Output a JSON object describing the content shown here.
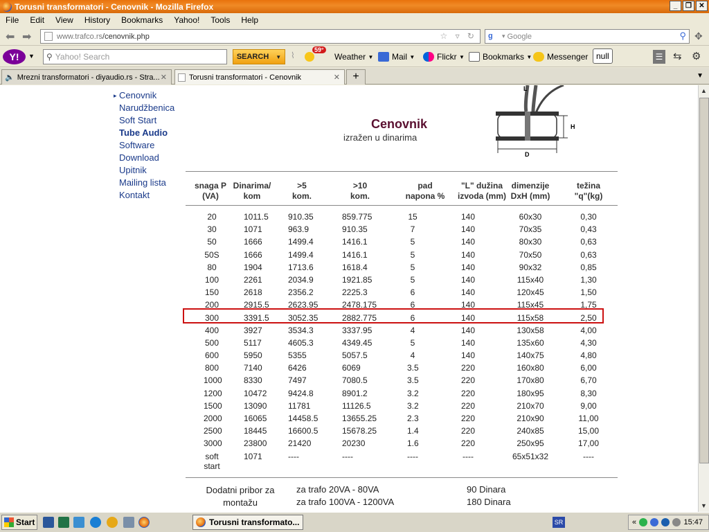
{
  "window": {
    "title": "Torusni transformatori - Cenovnik - Mozilla Firefox"
  },
  "menu": [
    "File",
    "Edit",
    "View",
    "History",
    "Bookmarks",
    "Yahoo!",
    "Tools",
    "Help"
  ],
  "nav": {
    "url_host": "www.trafco.rs",
    "url_path": "/cenovnik.php",
    "search_placeholder": "Google"
  },
  "yahoo_toolbar": {
    "search_placeholder": "Yahoo! Search",
    "search_button": "SEARCH",
    "weather_temp": "59°",
    "items": [
      "Weather",
      "Mail",
      "Flickr",
      "Bookmarks",
      "Messenger"
    ],
    "null_label": "null"
  },
  "tabs": [
    {
      "label": "Mrezni transformatori - diyaudio.rs - Stra...",
      "active": false
    },
    {
      "label": "Torusni transformatori - Cenovnik",
      "active": true
    }
  ],
  "sidenav": [
    {
      "label": "Cenovnik",
      "current": true,
      "bold": false
    },
    {
      "label": "Narudžbenica",
      "current": false,
      "bold": false
    },
    {
      "label": "Soft Start",
      "current": false,
      "bold": false
    },
    {
      "label": "Tube Audio",
      "current": false,
      "bold": true
    },
    {
      "label": "Software",
      "current": false,
      "bold": false
    },
    {
      "label": "Download",
      "current": false,
      "bold": false
    },
    {
      "label": "Upitnik",
      "current": false,
      "bold": false
    },
    {
      "label": "Mailing lista",
      "current": false,
      "bold": false
    },
    {
      "label": "Kontakt",
      "current": false,
      "bold": false
    }
  ],
  "page": {
    "heading": "Cenovnik",
    "subheading": "izražen u dinarima",
    "diagram_labels": {
      "L": "L",
      "H": "H",
      "D": "D"
    }
  },
  "table": {
    "headers": [
      [
        "snaga P",
        "(VA)"
      ],
      [
        "Dinarima/",
        "kom"
      ],
      [
        ">5",
        "kom."
      ],
      [
        ">10",
        "kom."
      ],
      [
        "pad",
        "napona %"
      ],
      [
        "\"L\" dužina",
        "izvoda (mm)"
      ],
      [
        "dimenzije",
        "DxH (mm)"
      ],
      [
        "težina",
        "\"q\"(kg)"
      ]
    ],
    "rows": [
      [
        "20",
        "1011.5",
        "910.35",
        "859.775",
        "15",
        "140",
        "60x30",
        "0,30"
      ],
      [
        "30",
        "1071",
        "963.9",
        "910.35",
        "7",
        "140",
        "70x35",
        "0,43"
      ],
      [
        "50",
        "1666",
        "1499.4",
        "1416.1",
        "5",
        "140",
        "80x30",
        "0,63"
      ],
      [
        "50S",
        "1666",
        "1499.4",
        "1416.1",
        "5",
        "140",
        "70x50",
        "0,63"
      ],
      [
        "80",
        "1904",
        "1713.6",
        "1618.4",
        "5",
        "140",
        "90x32",
        "0,85"
      ],
      [
        "100",
        "2261",
        "2034.9",
        "1921.85",
        "5",
        "140",
        "115x40",
        "1,30"
      ],
      [
        "150",
        "2618",
        "2356.2",
        "2225.3",
        "6",
        "140",
        "120x45",
        "1,50"
      ],
      [
        "200",
        "2915.5",
        "2623.95",
        "2478.175",
        "6",
        "140",
        "115x45",
        "1,75"
      ],
      [
        "300",
        "3391.5",
        "3052.35",
        "2882.775",
        "6",
        "140",
        "115x58",
        "2,50"
      ],
      [
        "400",
        "3927",
        "3534.3",
        "3337.95",
        "4",
        "140",
        "130x58",
        "4,00"
      ],
      [
        "500",
        "5117",
        "4605.3",
        "4349.45",
        "5",
        "140",
        "135x60",
        "4,30"
      ],
      [
        "600",
        "5950",
        "5355",
        "5057.5",
        "4",
        "140",
        "140x75",
        "4,80"
      ],
      [
        "800",
        "7140",
        "6426",
        "6069",
        "3.5",
        "220",
        "160x80",
        "6,00"
      ],
      [
        "1000",
        "8330",
        "7497",
        "7080.5",
        "3.5",
        "220",
        "170x80",
        "6,70"
      ],
      [
        "1200",
        "10472",
        "9424.8",
        "8901.2",
        "3.2",
        "220",
        "180x95",
        "8,30"
      ],
      [
        "1500",
        "13090",
        "11781",
        "11126.5",
        "3.2",
        "220",
        "210x70",
        "9,00"
      ],
      [
        "2000",
        "16065",
        "14458.5",
        "13655.25",
        "2.3",
        "220",
        "210x90",
        "11,00"
      ],
      [
        "2500",
        "18445",
        "16600.5",
        "15678.25",
        "1.4",
        "220",
        "240x85",
        "15,00"
      ],
      [
        "3000",
        "23800",
        "21420",
        "20230",
        "1.6",
        "220",
        "250x95",
        "17,00"
      ],
      [
        "soft start",
        "1071",
        "----",
        "----",
        "----",
        "----",
        "65x51x32",
        "----"
      ]
    ]
  },
  "extras": {
    "label_line1": "Dodatni pribor za",
    "label_line2": "montažu",
    "items": [
      {
        "item": "za trafo 20VA - 80VA",
        "price": "90 Dinara"
      },
      {
        "item": "za trafo 100VA - 1200VA",
        "price": "180 Dinara"
      }
    ]
  },
  "taskbar": {
    "start": "Start",
    "task": "Torusni transformato...",
    "lang": "SR",
    "time": "15:47"
  },
  "colors": {
    "heading": "#5a1030",
    "nav_link": "#1a3a8a",
    "highlight": "#cc1111"
  }
}
